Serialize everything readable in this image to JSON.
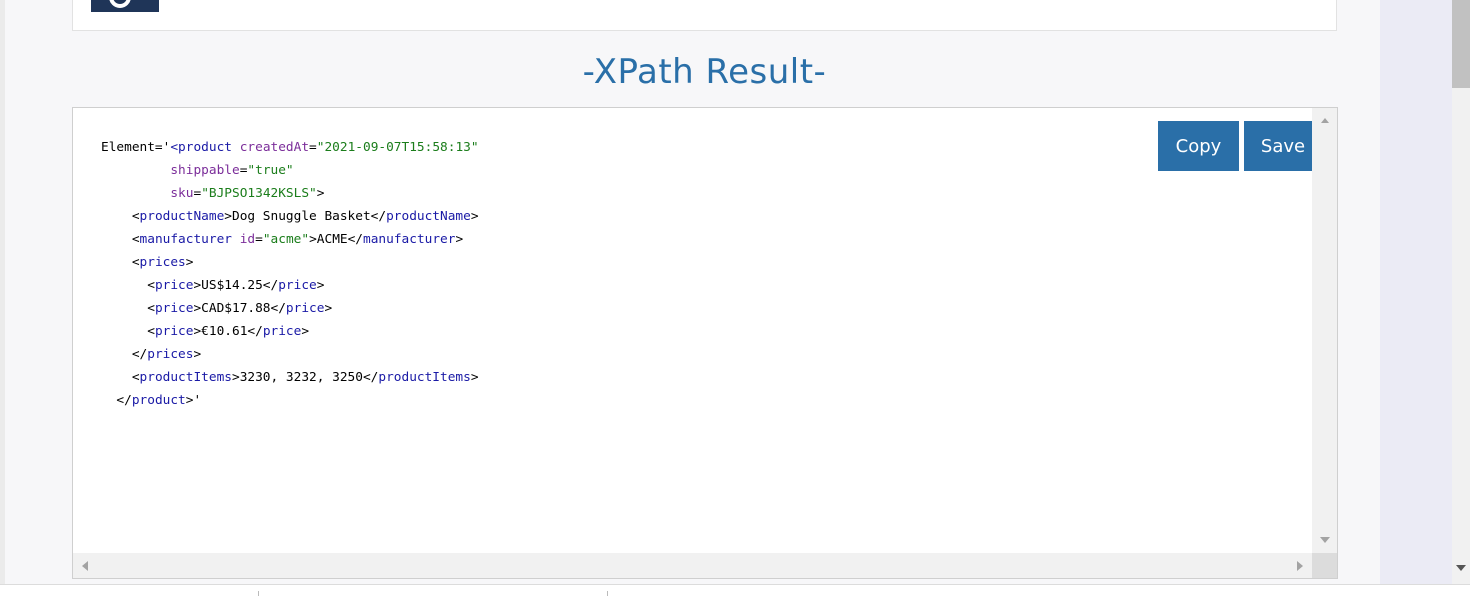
{
  "header": {
    "title": "-XPath Result-"
  },
  "toolbar": {
    "copy_label": "Copy",
    "save_label": "Save"
  },
  "result": {
    "lines": [
      [
        {
          "t": "plain",
          "s": "Element='"
        },
        {
          "t": "tag",
          "s": "<product"
        },
        {
          "t": "plain",
          "s": " "
        },
        {
          "t": "attr",
          "s": "createdAt"
        },
        {
          "t": "plain",
          "s": "="
        },
        {
          "t": "val",
          "s": "\"2021-09-07T15:58:13\""
        }
      ],
      [
        {
          "t": "plain",
          "s": "         "
        },
        {
          "t": "attr",
          "s": "shippable"
        },
        {
          "t": "plain",
          "s": "="
        },
        {
          "t": "val",
          "s": "\"true\""
        }
      ],
      [
        {
          "t": "plain",
          "s": "         "
        },
        {
          "t": "attr",
          "s": "sku"
        },
        {
          "t": "plain",
          "s": "="
        },
        {
          "t": "val",
          "s": "\"BJPSO1342KSLS\""
        },
        {
          "t": "plain",
          "s": ">"
        }
      ],
      [
        {
          "t": "plain",
          "s": "    <"
        },
        {
          "t": "tag",
          "s": "productName"
        },
        {
          "t": "plain",
          "s": ">Dog Snuggle Basket</"
        },
        {
          "t": "tag",
          "s": "productName"
        },
        {
          "t": "plain",
          "s": ">"
        }
      ],
      [
        {
          "t": "plain",
          "s": "    <"
        },
        {
          "t": "tag",
          "s": "manufacturer"
        },
        {
          "t": "plain",
          "s": " "
        },
        {
          "t": "attr",
          "s": "id"
        },
        {
          "t": "plain",
          "s": "="
        },
        {
          "t": "val",
          "s": "\"acme\""
        },
        {
          "t": "plain",
          "s": ">ACME</"
        },
        {
          "t": "tag",
          "s": "manufacturer"
        },
        {
          "t": "plain",
          "s": ">"
        }
      ],
      [
        {
          "t": "plain",
          "s": "    <"
        },
        {
          "t": "tag",
          "s": "prices"
        },
        {
          "t": "plain",
          "s": ">"
        }
      ],
      [
        {
          "t": "plain",
          "s": "      <"
        },
        {
          "t": "tag",
          "s": "price"
        },
        {
          "t": "plain",
          "s": ">US$14.25</"
        },
        {
          "t": "tag",
          "s": "price"
        },
        {
          "t": "plain",
          "s": ">"
        }
      ],
      [
        {
          "t": "plain",
          "s": "      <"
        },
        {
          "t": "tag",
          "s": "price"
        },
        {
          "t": "plain",
          "s": ">CAD$17.88</"
        },
        {
          "t": "tag",
          "s": "price"
        },
        {
          "t": "plain",
          "s": ">"
        }
      ],
      [
        {
          "t": "plain",
          "s": "      <"
        },
        {
          "t": "tag",
          "s": "price"
        },
        {
          "t": "plain",
          "s": ">€10.61</"
        },
        {
          "t": "tag",
          "s": "price"
        },
        {
          "t": "plain",
          "s": ">"
        }
      ],
      [
        {
          "t": "plain",
          "s": "    </"
        },
        {
          "t": "tag",
          "s": "prices"
        },
        {
          "t": "plain",
          "s": ">"
        }
      ],
      [
        {
          "t": "plain",
          "s": "    <"
        },
        {
          "t": "tag",
          "s": "productItems"
        },
        {
          "t": "plain",
          "s": ">3230, 3232, 3250</"
        },
        {
          "t": "tag",
          "s": "productItems"
        },
        {
          "t": "plain",
          "s": ">"
        }
      ],
      [
        {
          "t": "plain",
          "s": "  </"
        },
        {
          "t": "tag",
          "s": "product"
        },
        {
          "t": "plain",
          "s": ">'"
        }
      ]
    ]
  },
  "colors": {
    "accent": "#2a6fa8",
    "logo": "#1f3558",
    "syntax_tag": "#1a1aa6",
    "syntax_attr": "#7b2d9a",
    "syntax_value": "#1b7d1b"
  },
  "icons": {
    "editor_scroll_up": "scroll-up-arrow-icon",
    "editor_scroll_down": "scroll-down-arrow-icon",
    "editor_scroll_left": "scroll-left-arrow-icon",
    "editor_scroll_right": "scroll-right-arrow-icon",
    "logo": "logo-icon"
  }
}
